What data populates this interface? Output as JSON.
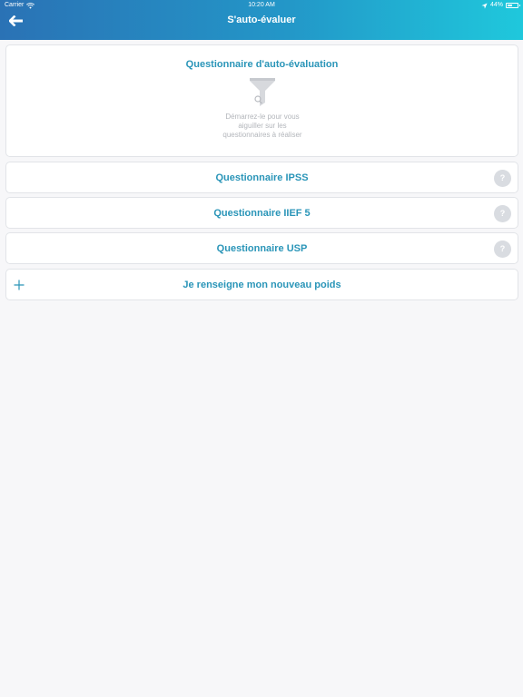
{
  "status_bar": {
    "carrier": "Carrier",
    "time": "10:20 AM",
    "battery": "44%"
  },
  "nav": {
    "title": "S'auto-évaluer",
    "back_icon": "arrow-left-icon"
  },
  "intro_card": {
    "title": "Questionnaire d'auto-évaluation",
    "icon": "funnel-icon",
    "description_lines": [
      "Démarrez-le pour vous",
      "aiguiller sur les",
      "questionnaires à réaliser"
    ]
  },
  "questionnaires": [
    {
      "label": "Questionnaire IPSS",
      "help": "?"
    },
    {
      "label": "Questionnaire IIEF 5",
      "help": "?"
    },
    {
      "label": "Questionnaire USP",
      "help": "?"
    }
  ],
  "weight_action": {
    "label": "Je renseigne mon nouveau poids",
    "icon": "plus-icon"
  },
  "colors": {
    "accent": "#2a95b8",
    "header_start": "#2a72b5",
    "header_end": "#1fc8dc",
    "background": "#f7f7f9"
  }
}
